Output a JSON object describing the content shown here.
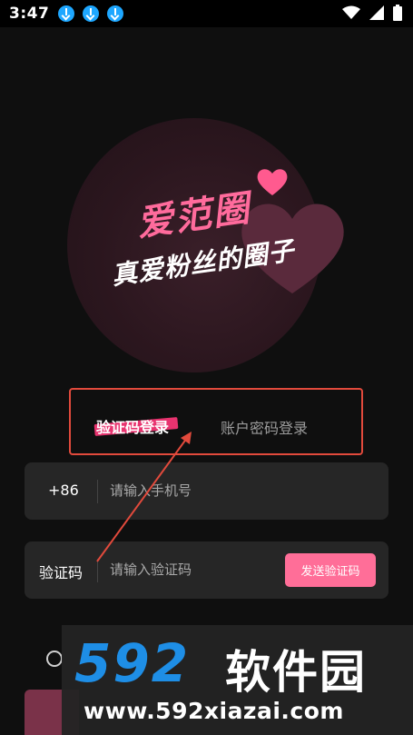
{
  "status_bar": {
    "time": "3:47",
    "icons": [
      "download-icon",
      "download-icon",
      "download-icon",
      "wifi-icon",
      "signal-icon",
      "battery-icon"
    ]
  },
  "logo": {
    "title": "爱范圈",
    "subtitle": "真爱粉丝的圈子",
    "accent_color": "#ff6b9c"
  },
  "login_tabs": {
    "active": "验证码登录",
    "inactive": "账户密码登录"
  },
  "phone_field": {
    "prefix": "+86",
    "placeholder": "请输入手机号",
    "value": ""
  },
  "code_field": {
    "label": "验证码",
    "placeholder": "请输入验证码",
    "value": "",
    "send_button": "发送验证码",
    "send_button_color": "#ff6e98"
  },
  "watermark": {
    "logo_digits": "592",
    "logo_text": "软件园",
    "url": "www.592xiazai.com"
  },
  "colors": {
    "background": "#0f0f0f",
    "field_background": "#262626",
    "annotation_red": "#e24a3c"
  }
}
